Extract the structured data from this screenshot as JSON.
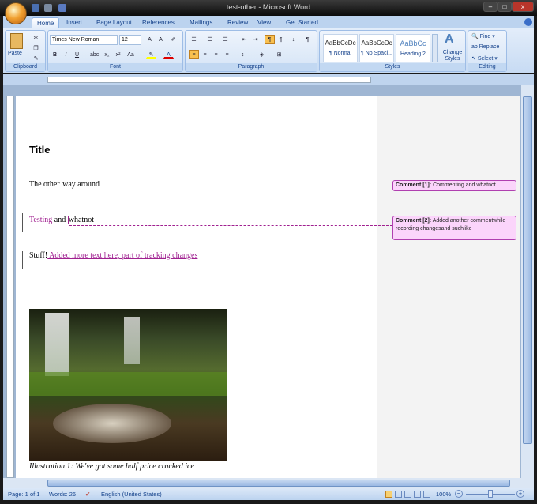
{
  "window": {
    "title": "test-other - Microsoft Word"
  },
  "tabs": [
    "Home",
    "Insert",
    "Page Layout",
    "References",
    "Mailings",
    "Review",
    "View",
    "Get Started"
  ],
  "ribbon": {
    "clipboard": {
      "label": "Clipboard",
      "paste": "Paste"
    },
    "font": {
      "label": "Font",
      "family": "Times New Roman",
      "size": "12",
      "buttons": [
        "B",
        "I",
        "U",
        "abc",
        "x₂",
        "x²",
        "Aa"
      ]
    },
    "paragraph": {
      "label": "Paragraph"
    },
    "styles": {
      "label": "Styles",
      "items": [
        {
          "preview": "AaBbCcDc",
          "name": "¶ Normal"
        },
        {
          "preview": "AaBbCcDc",
          "name": "¶ No Spaci..."
        },
        {
          "preview": "AaBbCc",
          "name": "Heading 2"
        }
      ],
      "change_styles": "Change Styles"
    },
    "editing": {
      "label": "Editing",
      "find": "Find",
      "replace": "Replace",
      "select": "Select"
    }
  },
  "document": {
    "title": "Title",
    "p1": {
      "a": "The other ",
      "b": "way around"
    },
    "p2": {
      "deleted": "Testing",
      "rest": " and ",
      "c": "whatnot"
    },
    "p3": {
      "a": "Stuff!",
      "inserted": " Added more text here, part of tracking changes"
    },
    "caption": "Illustration  1: We've got some half price cracked ice"
  },
  "comments": [
    {
      "label": "Comment [1]:",
      "text": "Commenting and whatnot"
    },
    {
      "label": "Comment [2]:",
      "text": "Added another commentwhile recording changesand suchlike"
    }
  ],
  "status": {
    "page": "Page: 1 of 1",
    "words": "Words: 26",
    "language": "English (United States)",
    "zoom": "100%"
  }
}
